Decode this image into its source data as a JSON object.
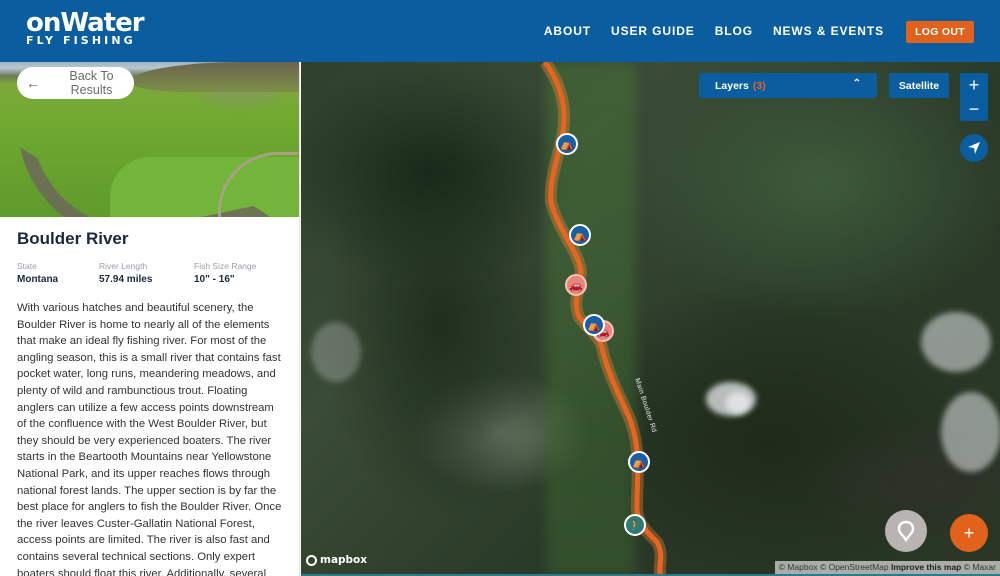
{
  "header": {
    "logo_top": "onWater",
    "logo_bottom": "FLY FISHING",
    "nav": [
      "ABOUT",
      "USER GUIDE",
      "BLOG",
      "NEWS & EVENTS"
    ],
    "logout_label": "LOG OUT"
  },
  "sidebar": {
    "back_label": "Back To Results",
    "title": "Boulder River",
    "stats": [
      {
        "label": "State",
        "value": "Montana"
      },
      {
        "label": "River Length",
        "value": "57.94 miles"
      },
      {
        "label": "Fish Size Range",
        "value": "10\" - 16\""
      }
    ],
    "description": "With various hatches and beautiful scenery, the Boulder River is home to nearly all of the elements that make an ideal fly fishing river. For most of the angling season, this is a small river that contains fast pocket water, long runs, meandering meadows, and plenty of wild and rambunctious trout. Floating anglers can utilize a few access points downstream of the confluence with the West Boulder River, but they should be very experienced boaters. The river starts in the Beartooth Mountains near Yellowstone National Park, and its upper reaches flows through national forest lands. The upper section is by far the best place for anglers to fish the Boulder River. Once the river leaves Custer-Gallatin National Forest, access points are limited. The river is also fast and contains several technical sections. Only expert boaters should float this river. Additionally, several"
  },
  "map": {
    "layers_label": "Layers",
    "layers_count": "(3)",
    "basemap_label": "Satellite",
    "zoom_in": "+",
    "zoom_out": "−",
    "add_label": "+",
    "road_label": "Main Boulder Rd",
    "mapbox_label": "mapbox",
    "attribution": {
      "mapbox": "© Mapbox",
      "osm": "© OpenStreetMap",
      "improve": "Improve this map",
      "maxar": "© Maxar"
    },
    "markers": [
      {
        "type": "campground",
        "icon": "tent-icon"
      },
      {
        "type": "campground",
        "icon": "tent-icon"
      },
      {
        "type": "parking",
        "icon": "car-icon"
      },
      {
        "type": "campground",
        "icon": "tent-icon"
      },
      {
        "type": "parking",
        "icon": "car-icon"
      },
      {
        "type": "campground",
        "icon": "tent-icon"
      },
      {
        "type": "trailhead",
        "icon": "hiker-icon"
      }
    ],
    "colors": {
      "route": "#e8651f",
      "campground": "#1a5fa6",
      "parking": "#e7857a",
      "trailhead": "#2f7a72"
    }
  },
  "colors": {
    "brand_blue": "#0a5ea0",
    "accent_orange": "#e2621c"
  }
}
